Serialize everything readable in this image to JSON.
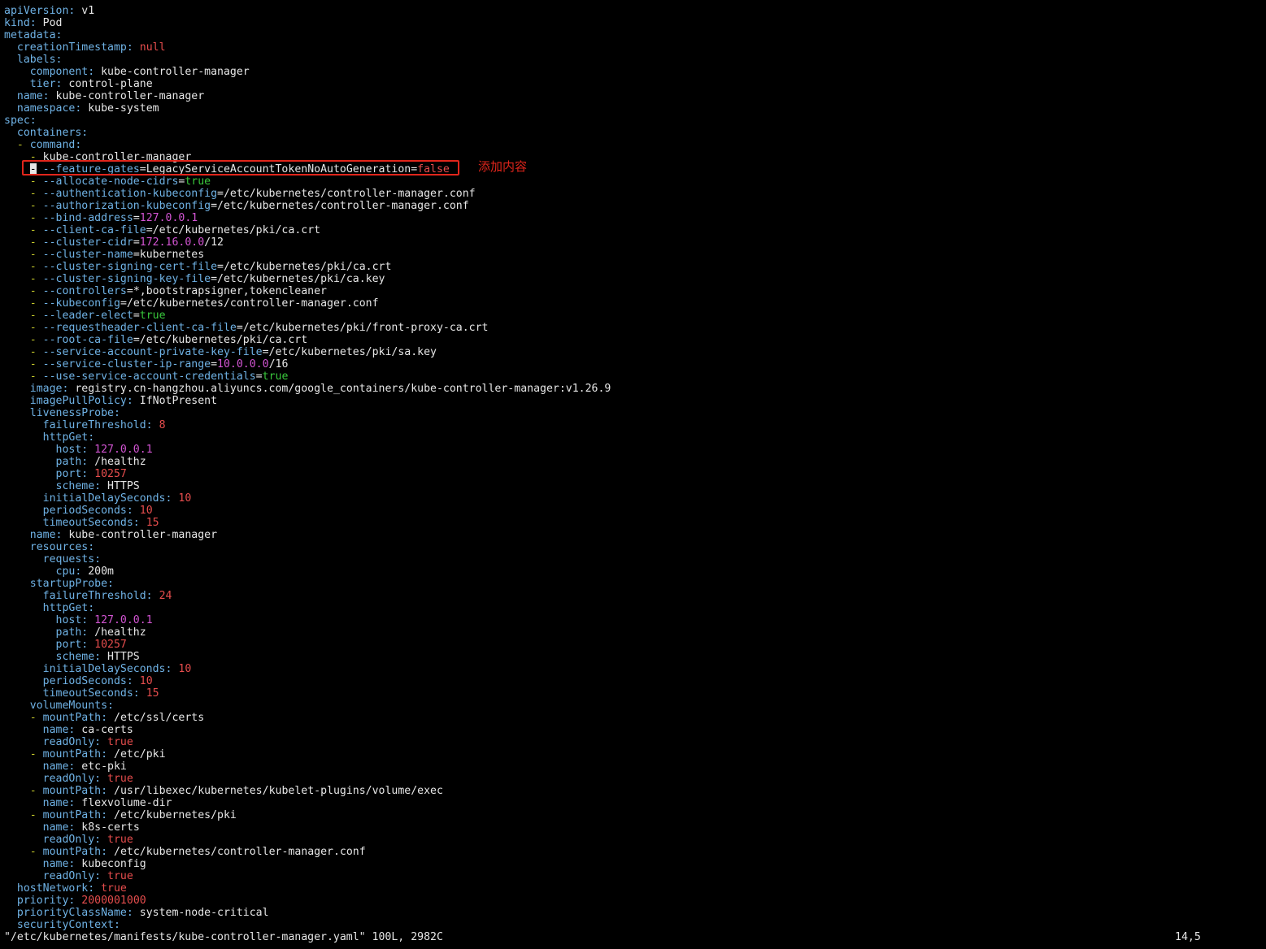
{
  "editor": {
    "lines": [
      [
        [
          "apiVersion",
          "key"
        ],
        [
          ": ",
          "key"
        ],
        [
          "v1",
          "val"
        ]
      ],
      [
        [
          "kind",
          "key"
        ],
        [
          ": ",
          "key"
        ],
        [
          "Pod",
          "val"
        ]
      ],
      [
        [
          "metadata:",
          "key"
        ]
      ],
      [
        [
          "  creationTimestamp",
          "key"
        ],
        [
          ": ",
          "key"
        ],
        [
          "null",
          "lit"
        ]
      ],
      [
        [
          "  labels:",
          "key"
        ]
      ],
      [
        [
          "    component",
          "key"
        ],
        [
          ": ",
          "key"
        ],
        [
          "kube-controller-manager",
          "val"
        ]
      ],
      [
        [
          "    tier",
          "key"
        ],
        [
          ": ",
          "key"
        ],
        [
          "control-plane",
          "val"
        ]
      ],
      [
        [
          "  name",
          "key"
        ],
        [
          ": ",
          "key"
        ],
        [
          "kube-controller-manager",
          "val"
        ]
      ],
      [
        [
          "  namespace",
          "key"
        ],
        [
          ": ",
          "key"
        ],
        [
          "kube-system",
          "val"
        ]
      ],
      [
        [
          "spec:",
          "key"
        ]
      ],
      [
        [
          "  containers:",
          "key"
        ]
      ],
      [
        [
          "  ",
          "val"
        ],
        [
          "- ",
          "dash"
        ],
        [
          "command:",
          "key"
        ]
      ],
      [
        [
          "    ",
          "val"
        ],
        [
          "- ",
          "dash"
        ],
        [
          "kube-controller-manager",
          "val"
        ]
      ],
      [
        [
          "    ",
          "val"
        ],
        [
          "-",
          "cursor"
        ],
        [
          " ",
          "val"
        ],
        [
          "--feature-gates",
          "key"
        ],
        [
          "=LegacyServiceAccountTokenNoAutoGeneration=",
          "val"
        ],
        [
          "false",
          "lit"
        ]
      ],
      [
        [
          "    ",
          "val"
        ],
        [
          "- ",
          "dash"
        ],
        [
          "--allocate-node-cidrs",
          "key"
        ],
        [
          "=",
          "val"
        ],
        [
          "true",
          "bool"
        ]
      ],
      [
        [
          "    ",
          "val"
        ],
        [
          "- ",
          "dash"
        ],
        [
          "--authentication-kubeconfig",
          "key"
        ],
        [
          "=/etc/kubernetes/controller-manager.conf",
          "val"
        ]
      ],
      [
        [
          "    ",
          "val"
        ],
        [
          "- ",
          "dash"
        ],
        [
          "--authorization-kubeconfig",
          "key"
        ],
        [
          "=/etc/kubernetes/controller-manager.conf",
          "val"
        ]
      ],
      [
        [
          "    ",
          "val"
        ],
        [
          "- ",
          "dash"
        ],
        [
          "--bind-address",
          "key"
        ],
        [
          "=",
          "val"
        ],
        [
          "127.0.0.1",
          "ip"
        ]
      ],
      [
        [
          "    ",
          "val"
        ],
        [
          "- ",
          "dash"
        ],
        [
          "--client-ca-file",
          "key"
        ],
        [
          "=/etc/kubernetes/pki/ca.crt",
          "val"
        ]
      ],
      [
        [
          "    ",
          "val"
        ],
        [
          "- ",
          "dash"
        ],
        [
          "--cluster-cidr",
          "key"
        ],
        [
          "=",
          "val"
        ],
        [
          "172.16.0.0",
          "ip"
        ],
        [
          "/12",
          "val"
        ]
      ],
      [
        [
          "    ",
          "val"
        ],
        [
          "- ",
          "dash"
        ],
        [
          "--cluster-name",
          "key"
        ],
        [
          "=kubernetes",
          "val"
        ]
      ],
      [
        [
          "    ",
          "val"
        ],
        [
          "- ",
          "dash"
        ],
        [
          "--cluster-signing-cert-file",
          "key"
        ],
        [
          "=/etc/kubernetes/pki/ca.crt",
          "val"
        ]
      ],
      [
        [
          "    ",
          "val"
        ],
        [
          "- ",
          "dash"
        ],
        [
          "--cluster-signing-key-file",
          "key"
        ],
        [
          "=/etc/kubernetes/pki/ca.key",
          "val"
        ]
      ],
      [
        [
          "    ",
          "val"
        ],
        [
          "- ",
          "dash"
        ],
        [
          "--controllers",
          "key"
        ],
        [
          "=*,bootstrapsigner,tokencleaner",
          "val"
        ]
      ],
      [
        [
          "    ",
          "val"
        ],
        [
          "- ",
          "dash"
        ],
        [
          "--kubeconfig",
          "key"
        ],
        [
          "=/etc/kubernetes/controller-manager.conf",
          "val"
        ]
      ],
      [
        [
          "    ",
          "val"
        ],
        [
          "- ",
          "dash"
        ],
        [
          "--leader-elect",
          "key"
        ],
        [
          "=",
          "val"
        ],
        [
          "true",
          "bool"
        ]
      ],
      [
        [
          "    ",
          "val"
        ],
        [
          "- ",
          "dash"
        ],
        [
          "--requestheader-client-ca-file",
          "key"
        ],
        [
          "=/etc/kubernetes/pki/front-proxy-ca.crt",
          "val"
        ]
      ],
      [
        [
          "    ",
          "val"
        ],
        [
          "- ",
          "dash"
        ],
        [
          "--root-ca-file",
          "key"
        ],
        [
          "=/etc/kubernetes/pki/ca.crt",
          "val"
        ]
      ],
      [
        [
          "    ",
          "val"
        ],
        [
          "- ",
          "dash"
        ],
        [
          "--service-account-private-key-file",
          "key"
        ],
        [
          "=/etc/kubernetes/pki/sa.key",
          "val"
        ]
      ],
      [
        [
          "    ",
          "val"
        ],
        [
          "- ",
          "dash"
        ],
        [
          "--service-cluster-ip-range",
          "key"
        ],
        [
          "=",
          "val"
        ],
        [
          "10.0.0.0",
          "ip"
        ],
        [
          "/16",
          "val"
        ]
      ],
      [
        [
          "    ",
          "val"
        ],
        [
          "- ",
          "dash"
        ],
        [
          "--use-service-account-credentials",
          "key"
        ],
        [
          "=",
          "val"
        ],
        [
          "true",
          "bool"
        ]
      ],
      [
        [
          "    image",
          "key"
        ],
        [
          ": ",
          "key"
        ],
        [
          "registry.cn-hangzhou.aliyuncs.com/google_containers/kube-controller-manager:v1.26.9",
          "val"
        ]
      ],
      [
        [
          "    imagePullPolicy",
          "key"
        ],
        [
          ": ",
          "key"
        ],
        [
          "IfNotPresent",
          "val"
        ]
      ],
      [
        [
          "    livenessProbe:",
          "key"
        ]
      ],
      [
        [
          "      failureThreshold",
          "key"
        ],
        [
          ": ",
          "key"
        ],
        [
          "8",
          "num"
        ]
      ],
      [
        [
          "      httpGet:",
          "key"
        ]
      ],
      [
        [
          "        host",
          "key"
        ],
        [
          ": ",
          "key"
        ],
        [
          "127.0.0.1",
          "ip"
        ]
      ],
      [
        [
          "        path",
          "key"
        ],
        [
          ": ",
          "key"
        ],
        [
          "/healthz",
          "val"
        ]
      ],
      [
        [
          "        port",
          "key"
        ],
        [
          ": ",
          "key"
        ],
        [
          "10257",
          "num"
        ]
      ],
      [
        [
          "        scheme",
          "key"
        ],
        [
          ": ",
          "key"
        ],
        [
          "HTTPS",
          "val"
        ]
      ],
      [
        [
          "      initialDelaySeconds",
          "key"
        ],
        [
          ": ",
          "key"
        ],
        [
          "10",
          "num"
        ]
      ],
      [
        [
          "      periodSeconds",
          "key"
        ],
        [
          ": ",
          "key"
        ],
        [
          "10",
          "num"
        ]
      ],
      [
        [
          "      timeoutSeconds",
          "key"
        ],
        [
          ": ",
          "key"
        ],
        [
          "15",
          "num"
        ]
      ],
      [
        [
          "    name",
          "key"
        ],
        [
          ": ",
          "key"
        ],
        [
          "kube-controller-manager",
          "val"
        ]
      ],
      [
        [
          "    resources:",
          "key"
        ]
      ],
      [
        [
          "      requests:",
          "key"
        ]
      ],
      [
        [
          "        cpu",
          "key"
        ],
        [
          ": ",
          "key"
        ],
        [
          "200m",
          "val"
        ]
      ],
      [
        [
          "    startupProbe:",
          "key"
        ]
      ],
      [
        [
          "      failureThreshold",
          "key"
        ],
        [
          ": ",
          "key"
        ],
        [
          "24",
          "num"
        ]
      ],
      [
        [
          "      httpGet:",
          "key"
        ]
      ],
      [
        [
          "        host",
          "key"
        ],
        [
          ": ",
          "key"
        ],
        [
          "127.0.0.1",
          "ip"
        ]
      ],
      [
        [
          "        path",
          "key"
        ],
        [
          ": ",
          "key"
        ],
        [
          "/healthz",
          "val"
        ]
      ],
      [
        [
          "        port",
          "key"
        ],
        [
          ": ",
          "key"
        ],
        [
          "10257",
          "num"
        ]
      ],
      [
        [
          "        scheme",
          "key"
        ],
        [
          ": ",
          "key"
        ],
        [
          "HTTPS",
          "val"
        ]
      ],
      [
        [
          "      initialDelaySeconds",
          "key"
        ],
        [
          ": ",
          "key"
        ],
        [
          "10",
          "num"
        ]
      ],
      [
        [
          "      periodSeconds",
          "key"
        ],
        [
          ": ",
          "key"
        ],
        [
          "10",
          "num"
        ]
      ],
      [
        [
          "      timeoutSeconds",
          "key"
        ],
        [
          ": ",
          "key"
        ],
        [
          "15",
          "num"
        ]
      ],
      [
        [
          "    volumeMounts:",
          "key"
        ]
      ],
      [
        [
          "    ",
          "val"
        ],
        [
          "- ",
          "dash"
        ],
        [
          "mountPath",
          "key"
        ],
        [
          ": ",
          "key"
        ],
        [
          "/etc/ssl/certs",
          "val"
        ]
      ],
      [
        [
          "      name",
          "key"
        ],
        [
          ": ",
          "key"
        ],
        [
          "ca-certs",
          "val"
        ]
      ],
      [
        [
          "      readOnly",
          "key"
        ],
        [
          ": ",
          "key"
        ],
        [
          "true",
          "lit"
        ]
      ],
      [
        [
          "    ",
          "val"
        ],
        [
          "- ",
          "dash"
        ],
        [
          "mountPath",
          "key"
        ],
        [
          ": ",
          "key"
        ],
        [
          "/etc/pki",
          "val"
        ]
      ],
      [
        [
          "      name",
          "key"
        ],
        [
          ": ",
          "key"
        ],
        [
          "etc-pki",
          "val"
        ]
      ],
      [
        [
          "      readOnly",
          "key"
        ],
        [
          ": ",
          "key"
        ],
        [
          "true",
          "lit"
        ]
      ],
      [
        [
          "    ",
          "val"
        ],
        [
          "- ",
          "dash"
        ],
        [
          "mountPath",
          "key"
        ],
        [
          ": ",
          "key"
        ],
        [
          "/usr/libexec/kubernetes/kubelet-plugins/volume/exec",
          "val"
        ]
      ],
      [
        [
          "      name",
          "key"
        ],
        [
          ": ",
          "key"
        ],
        [
          "flexvolume-dir",
          "val"
        ]
      ],
      [
        [
          "    ",
          "val"
        ],
        [
          "- ",
          "dash"
        ],
        [
          "mountPath",
          "key"
        ],
        [
          ": ",
          "key"
        ],
        [
          "/etc/kubernetes/pki",
          "val"
        ]
      ],
      [
        [
          "      name",
          "key"
        ],
        [
          ": ",
          "key"
        ],
        [
          "k8s-certs",
          "val"
        ]
      ],
      [
        [
          "      readOnly",
          "key"
        ],
        [
          ": ",
          "key"
        ],
        [
          "true",
          "lit"
        ]
      ],
      [
        [
          "    ",
          "val"
        ],
        [
          "- ",
          "dash"
        ],
        [
          "mountPath",
          "key"
        ],
        [
          ": ",
          "key"
        ],
        [
          "/etc/kubernetes/controller-manager.conf",
          "val"
        ]
      ],
      [
        [
          "      name",
          "key"
        ],
        [
          ": ",
          "key"
        ],
        [
          "kubeconfig",
          "val"
        ]
      ],
      [
        [
          "      readOnly",
          "key"
        ],
        [
          ": ",
          "key"
        ],
        [
          "true",
          "lit"
        ]
      ],
      [
        [
          "  hostNetwork",
          "key"
        ],
        [
          ": ",
          "key"
        ],
        [
          "true",
          "lit"
        ]
      ],
      [
        [
          "  priority",
          "key"
        ],
        [
          ": ",
          "key"
        ],
        [
          "2000001000",
          "num"
        ]
      ],
      [
        [
          "  priorityClassName",
          "key"
        ],
        [
          ": ",
          "key"
        ],
        [
          "system-node-critical",
          "val"
        ]
      ],
      [
        [
          "  securityContext:",
          "key"
        ]
      ]
    ]
  },
  "annotation": {
    "text": "添加内容"
  },
  "status": {
    "file": "\"/etc/kubernetes/manifests/kube-controller-manager.yaml\" 100L, 2982C",
    "position": "14,5"
  },
  "colors": {
    "background": "#000000",
    "key": "#6fb2e5",
    "value": "#e6e6e6",
    "number": "#e64d4d",
    "ip": "#d254d2",
    "bool": "#39c83c",
    "dash": "#c5c92a",
    "highlight": "#e1251b"
  }
}
